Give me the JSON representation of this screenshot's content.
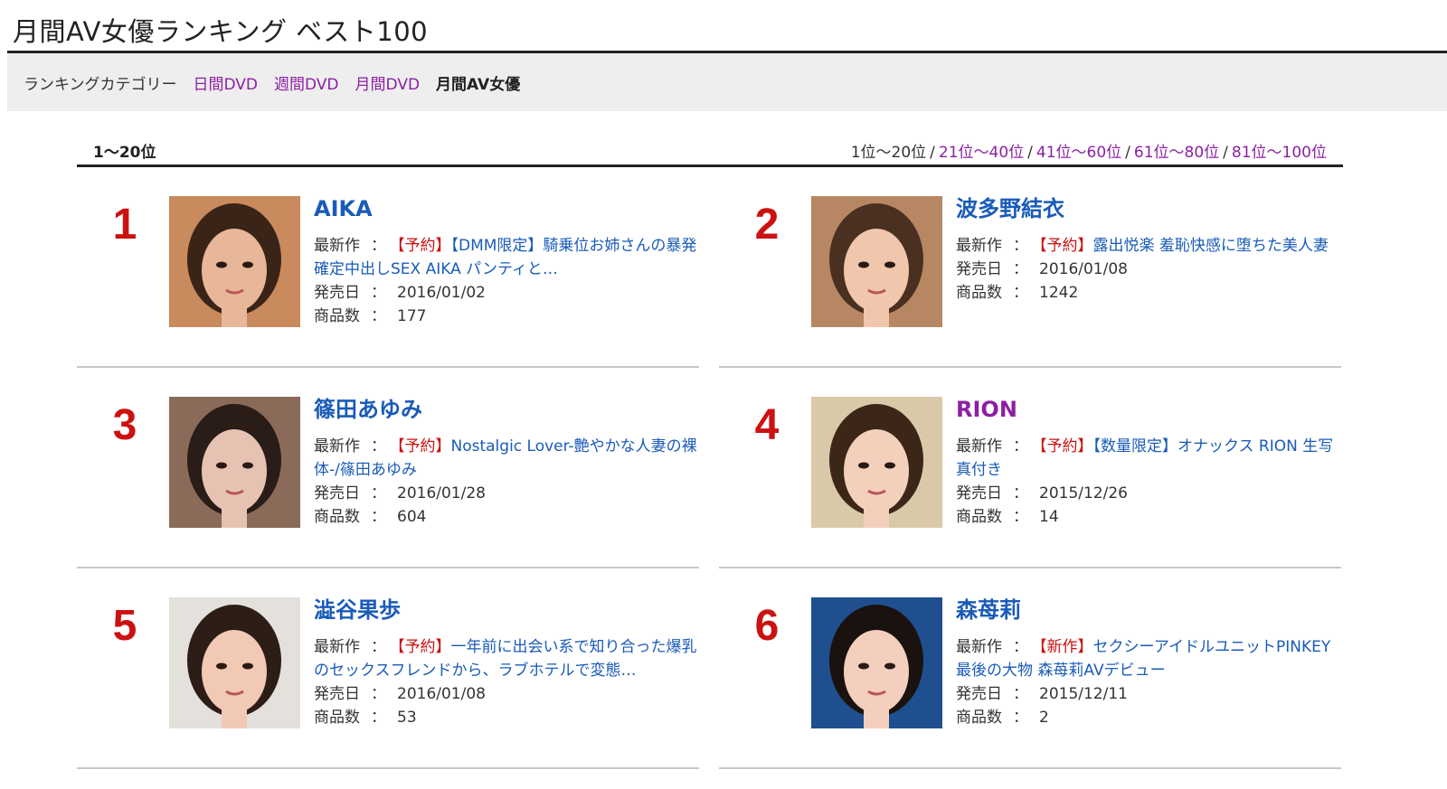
{
  "page": {
    "title": "月間AV女優ランキング ベスト100"
  },
  "category_bar": {
    "label": "ランキングカテゴリー",
    "links": [
      "日間DVD",
      "週間DVD",
      "月間DVD"
    ],
    "current": "月間AV女優"
  },
  "range": {
    "current": "1～20位",
    "pager": {
      "current": "1位～20位",
      "links": [
        "21位～40位",
        "41位～60位",
        "61位～80位",
        "81位～100位"
      ],
      "separator": "/"
    }
  },
  "labels": {
    "latest": "最新作",
    "release_date": "発売日",
    "product_count": "商品数",
    "colon": "："
  },
  "colors": {
    "rank": "#cc1111",
    "link": "#1a5bb8",
    "visited": "#8c1fa3",
    "tag": "#cc1111",
    "category_bg": "#eeeeee"
  },
  "actresses": [
    {
      "rank": "1",
      "name": "AIKA",
      "visited": false,
      "latest_tag": "【予約】",
      "latest_title": "【DMM限定】騎乗位お姉さんの暴発確定中出しSEX AIKA パンティと…",
      "release_date": "2016/01/02",
      "product_count": "177",
      "photo_icon": "portrait-photo-icon"
    },
    {
      "rank": "2",
      "name": "波多野結衣",
      "visited": false,
      "latest_tag": "【予約】",
      "latest_title": "露出悦楽 羞恥快感に堕ちた美人妻",
      "release_date": "2016/01/08",
      "product_count": "1242",
      "photo_icon": "portrait-photo-icon"
    },
    {
      "rank": "3",
      "name": "篠田あゆみ",
      "visited": false,
      "latest_tag": "【予約】",
      "latest_title": "Nostalgic Lover-艶やかな人妻の裸体-/篠田あゆみ",
      "release_date": "2016/01/28",
      "product_count": "604",
      "photo_icon": "portrait-photo-icon"
    },
    {
      "rank": "4",
      "name": "RION",
      "visited": true,
      "latest_tag": "【予約】",
      "latest_title": "【数量限定】オナックス RION 生写真付き",
      "release_date": "2015/12/26",
      "product_count": "14",
      "photo_icon": "portrait-photo-icon"
    },
    {
      "rank": "5",
      "name": "澁谷果歩",
      "visited": false,
      "latest_tag": "【予約】",
      "latest_title": "一年前に出会い系で知り合った爆乳のセックスフレンドから、ラブホテルで変態…",
      "release_date": "2016/01/08",
      "product_count": "53",
      "photo_icon": "portrait-photo-icon"
    },
    {
      "rank": "6",
      "name": "森苺莉",
      "visited": false,
      "latest_tag": "【新作】",
      "latest_title": "セクシーアイドルユニットPINKEY最後の大物 森苺莉AVデビュー",
      "release_date": "2015/12/11",
      "product_count": "2",
      "photo_icon": "portrait-photo-icon"
    }
  ]
}
